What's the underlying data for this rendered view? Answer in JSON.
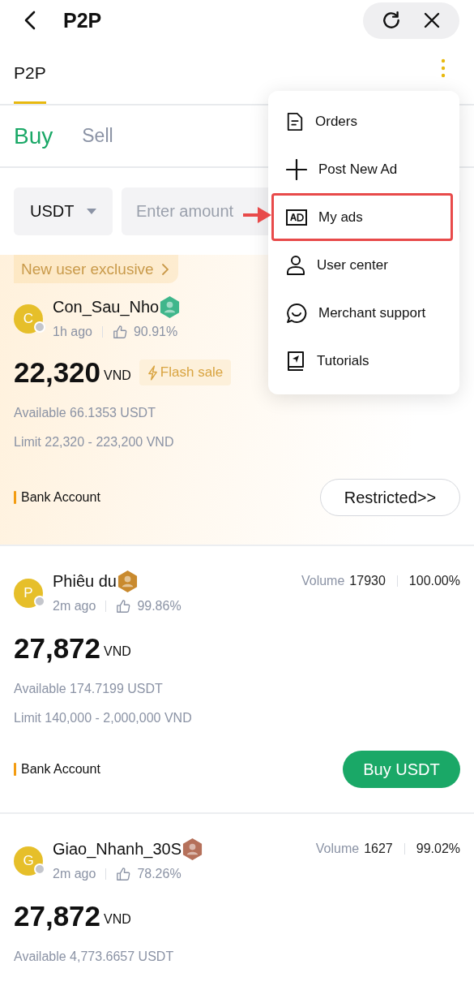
{
  "header": {
    "title": "P2P"
  },
  "tabs": [
    {
      "label": "P2P",
      "selected": true
    }
  ],
  "trade_tabs": [
    {
      "label": "Buy",
      "selected": true
    },
    {
      "label": "Sell",
      "selected": false
    }
  ],
  "filters": {
    "currency": "USDT",
    "amount": {
      "placeholder": "Enter amount"
    }
  },
  "ads": [
    {
      "promo": "New user exclusive",
      "highlighted": true,
      "avatar": "C",
      "name": "Con_Sau_Nho",
      "color": "#3fb68b",
      "time": "1h ago",
      "rating": "90.91%",
      "price": "22,320",
      "currency": "VND",
      "tag": "Flash sale",
      "available": "Available 66.1353 USDT",
      "limit": "Limit 22,320 - 223,200 VND",
      "payment": "Bank Account",
      "action": {
        "kind": "outline",
        "label": "Restricted>>"
      }
    },
    {
      "highlighted": false,
      "avatar": "P",
      "name": "Phiêu du",
      "color": "#c98a2e",
      "volume_label": "Volume",
      "volume": "17930",
      "completion": "100.00%",
      "time": "2m ago",
      "rating": "99.86%",
      "price": "27,872",
      "currency": "VND",
      "available": "Available 174.7199 USDT",
      "limit": "Limit 140,000 - 2,000,000 VND",
      "payment": "Bank Account",
      "action": {
        "kind": "primary",
        "label": "Buy USDT"
      }
    },
    {
      "highlighted": false,
      "avatar": "G",
      "name": "Giao_Nhanh_30S",
      "color": "#b5705a",
      "volume_label": "Volume",
      "volume": "1627",
      "completion": "99.02%",
      "time": "2m ago",
      "rating": "78.26%",
      "price": "27,872",
      "currency": "VND",
      "available": "Available 4,773.6657 USDT"
    }
  ],
  "menu": [
    {
      "kind": "orders",
      "label": "Orders",
      "highlighted": false
    },
    {
      "kind": "add",
      "label": "Post New Ad",
      "highlighted": false
    },
    {
      "kind": "ads",
      "label": "My ads",
      "highlighted": true
    },
    {
      "kind": "user",
      "label": "User center",
      "highlighted": false
    },
    {
      "kind": "support",
      "label": "Merchant support",
      "highlighted": false
    },
    {
      "kind": "tutorials",
      "label": "Tutorials",
      "highlighted": false
    }
  ]
}
